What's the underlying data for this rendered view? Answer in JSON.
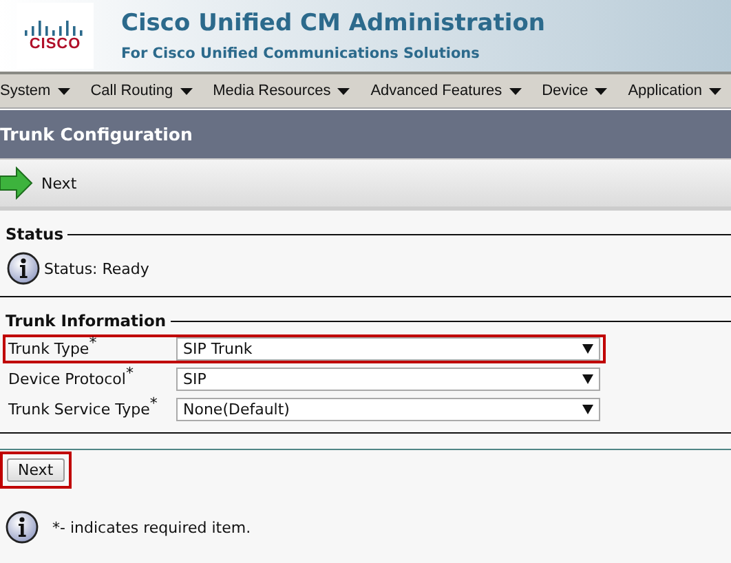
{
  "header": {
    "logo": "CISCO",
    "title": "Cisco Unified CM Administration",
    "subtitle": "For Cisco Unified Communications Solutions"
  },
  "menu": [
    {
      "label": "System"
    },
    {
      "label": "Call Routing"
    },
    {
      "label": "Media Resources"
    },
    {
      "label": "Advanced Features"
    },
    {
      "label": "Device"
    },
    {
      "label": "Application"
    }
  ],
  "page_title": "Trunk Configuration",
  "toolbar": {
    "label": "Next"
  },
  "status": {
    "legend": "Status",
    "text": "Status: Ready"
  },
  "trunk_information": {
    "legend": "Trunk Information",
    "fields": [
      {
        "label": "Trunk Type$^{*}$",
        "value": "SIP Trunk",
        "highlighted": true
      },
      {
        "label": "Device Protocol$^{*}$",
        "value": "SIP",
        "highlighted": false
      },
      {
        "label": "Trunk Service Type$^{*}$",
        "value": "None(Default)",
        "highlighted": false
      }
    ]
  },
  "next_button": {
    "label": "Next",
    "highlighted": true
  },
  "footnote": "*- indicates required item."
}
